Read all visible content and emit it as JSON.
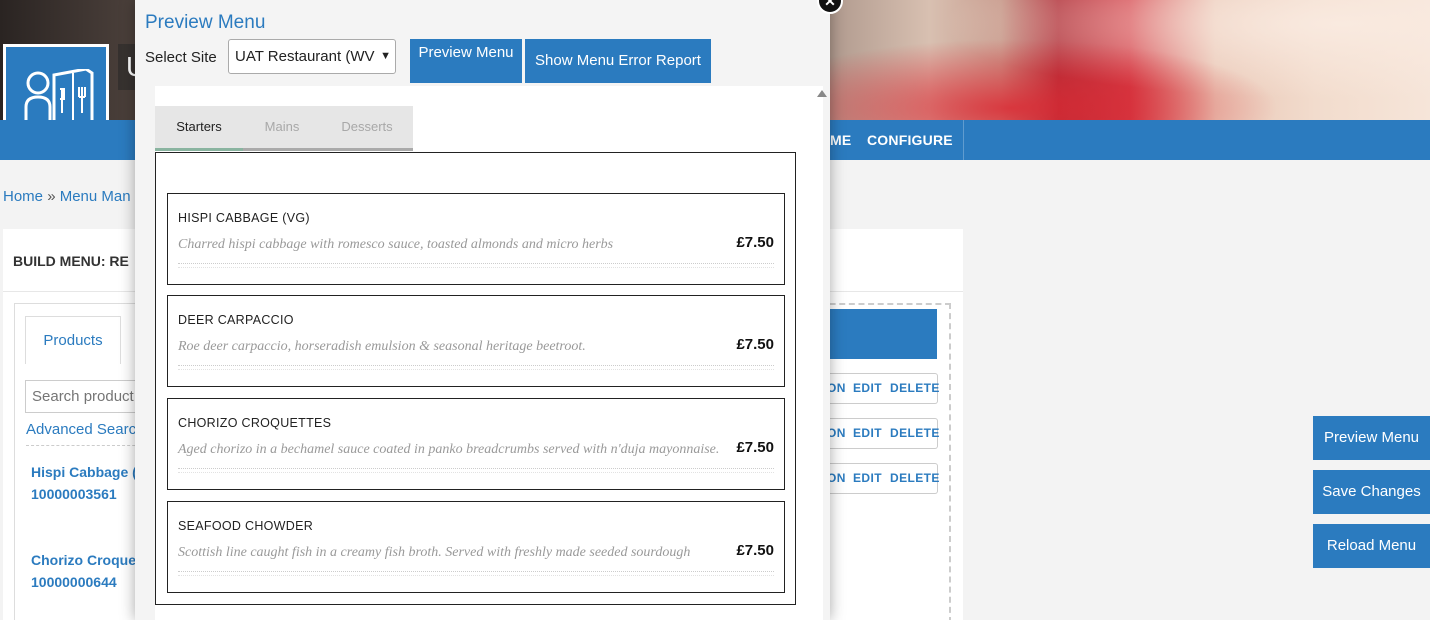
{
  "nav": {
    "items": [
      "ME",
      "CONFIGURE"
    ]
  },
  "app": {
    "title_fragment": "U"
  },
  "breadcrumb": {
    "home": "Home",
    "sep": "»",
    "current": "Menu Man"
  },
  "build": {
    "title": "BUILD MENU: RE",
    "products_tab": "Products",
    "search_placeholder": "Search product",
    "advanced_search": "Advanced Searc",
    "products": [
      {
        "name": "Hispi Cabbage (V",
        "code": "10000003561"
      },
      {
        "name": "Chorizo Croque",
        "code": "10000000644"
      }
    ],
    "row_actions": {
      "action_fragment": "ON",
      "edit": "EDIT",
      "delete": "DELETE"
    }
  },
  "side_buttons": {
    "preview": "Preview Menu",
    "save": "Save Changes",
    "reload": "Reload Menu"
  },
  "modal": {
    "title": "Preview Menu",
    "close_glyph": "✕",
    "site_label": "Select Site",
    "site_selected": "UAT Restaurant (WV",
    "preview_button": "Preview Menu",
    "error_report_button": "Show Menu Error Report",
    "tabs": [
      "Starters",
      "Mains",
      "Desserts"
    ],
    "active_tab": "Starters",
    "items": [
      {
        "name": "HISPI CABBAGE (VG)",
        "description": "Charred hispi cabbage with romesco sauce, toasted almonds and micro herbs",
        "price": "£7.50"
      },
      {
        "name": "DEER CARPACCIO",
        "description": "Roe deer carpaccio, horseradish emulsion & seasonal heritage beetroot.",
        "price": "£7.50"
      },
      {
        "name": "CHORIZO CROQUETTES",
        "description": "Aged chorizo in a bechamel sauce coated in panko breadcrumbs served with n'duja mayonnaise.",
        "price": "£7.50"
      },
      {
        "name": "SEAFOOD CHOWDER",
        "description": "Scottish line caught fish in a creamy fish broth. Served with freshly made seeded sourdough",
        "price": "£7.50"
      }
    ]
  },
  "colors": {
    "brand_blue": "#2b7bbf",
    "tab_active_accent": "#8ab4a0"
  }
}
